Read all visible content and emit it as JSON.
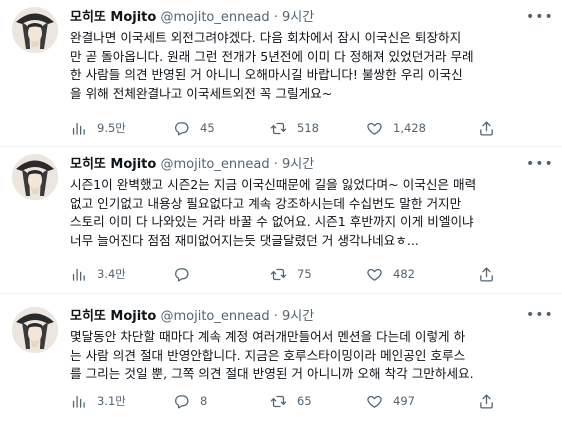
{
  "colors": {
    "text": "#0f1419",
    "secondary": "#536471",
    "divider": "#eff3f4"
  },
  "tweets": [
    {
      "author": {
        "name": "모히또 Mojito",
        "handle": "@mojito_ennead",
        "dot": "·",
        "time": "9시간"
      },
      "text_lines": [
        "완결나면 이국세트 외전그려야겠다. 다음 회차에서 잠시 이국신은 퇴장하지",
        "만 곧 돌아옵니다. 원래 그런 전개가 5년전에 이미 다 정해져 있었던거라 무례",
        "한 사람들 의견 반영된 거 아니니 오해마시길 바랍니다! 불쌍한 우리 이국신",
        "을 위해 전체완결나고 이국세트외전 꼭 그릴게요~"
      ],
      "stats": {
        "views": "9.5만",
        "replies": "45",
        "retweets": "518",
        "likes": "1,428"
      }
    },
    {
      "author": {
        "name": "모히또 Mojito",
        "handle": "@mojito_ennead",
        "dot": "·",
        "time": "9시간"
      },
      "text_lines": [
        "시즌1이 완벽했고 시즌2는 지금 이국신때문에 길을 잃었다며~ 이국신은 매력",
        "없고 인기없고 내용상 필요없다고 계속 강조하시는데 수십번도 말한 거지만",
        "스토리 이미 다 나와있는 거라 바꿀 수 없어요. 시즌1 후반까지 이게 비엘이냐",
        "너무 늘어진다 점점 재미없어지는듯 댓글달렸던 거 생각나네요ㅎ..."
      ],
      "stats": {
        "views": "3.4만",
        "replies": "",
        "retweets": "75",
        "likes": "482"
      }
    },
    {
      "author": {
        "name": "모히또 Mojito",
        "handle": "@mojito_ennead",
        "dot": "·",
        "time": "9시간"
      },
      "text_lines": [
        "몇달동안 차단할 때마다 계속 계정 여러개만들어서 멘션을 다는데 이렇게 하",
        "는 사람 의견 절대 반영안합니다. 지금은 호루스타이밍이라 메인공인 호루스",
        "를 그리는 것일 뿐, 그쪽 의견 절대 반영된 거 아니니까 오해 착각 그만하세요."
      ],
      "stats": {
        "views": "3.1만",
        "replies": "8",
        "retweets": "65",
        "likes": "497"
      }
    }
  ],
  "icons": {
    "avatar": "avatar-pharaoh-headdress",
    "more": "more-horizontal-icon",
    "views": "analytics-bar-icon",
    "reply": "reply-bubble-icon",
    "retweet": "retweet-icon",
    "like": "heart-icon",
    "share": "share-upload-icon"
  }
}
